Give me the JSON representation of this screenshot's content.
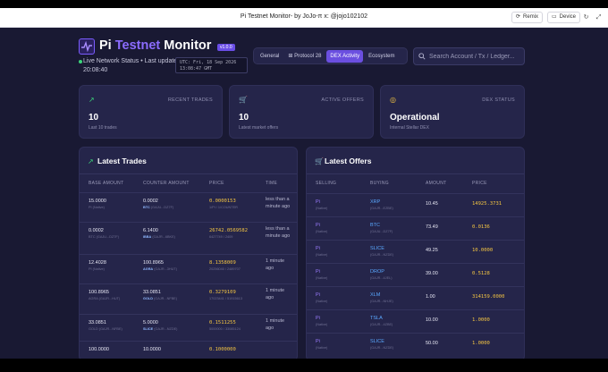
{
  "browser": {
    "title": "Pi Testnet Monitor- by JoJo-π x: @jojo102102",
    "remix_label": "Remix",
    "device_label": "Device"
  },
  "header": {
    "title_pi": "Pi",
    "title_testnet": "Testnet",
    "title_monitor": "Monitor",
    "version": "v1.0.0",
    "status_text": "Live Network Status • Last updated 20:08:40",
    "utc_line1": "UTC: Fri, 18 Sep 2026",
    "utc_line2": "13:08:47 GMT"
  },
  "tabs": [
    {
      "label": "General"
    },
    {
      "label": "Protocol 28"
    },
    {
      "label": "DEX Activity"
    },
    {
      "label": "Ecosystem"
    }
  ],
  "search": {
    "placeholder": "Search Account / Tx / Ledger..."
  },
  "cards": [
    {
      "label": "RECENT TRADES",
      "value": "10",
      "sub": "Last 10 trades"
    },
    {
      "label": "ACTIVE OFFERS",
      "value": "10",
      "sub": "Latest market offers"
    },
    {
      "label": "DEX STATUS",
      "value": "Operational",
      "sub": "Internal Stellar DEX"
    }
  ],
  "trades": {
    "title": "Latest Trades",
    "headers": [
      "BASE AMOUNT",
      "COUNTER AMOUNT",
      "PRICE",
      "TIME"
    ],
    "rows": [
      {
        "base": "15.0000",
        "base_sub": "PI (Native)",
        "counter": "0.0002",
        "counter_tk": "BTC",
        "counter_sub": "(GAJU...DZ7F)",
        "price": "0.0000153",
        "price_sub": "1/PI / 1/COUNTER",
        "time": "less than a minute ago"
      },
      {
        "base": "0.0002",
        "base_sub": "BTC (GAJU...DZ7F)",
        "counter": "6.1400",
        "counter_tk": "IBBA",
        "counter_sub": "(GAJR...6BKE)",
        "price": "26742.0569582",
        "price_sub": "6427749 / 2409",
        "time": "less than a minute ago"
      },
      {
        "base": "12.4028",
        "base_sub": "PI (Native)",
        "counter": "100.8965",
        "counter_tk": "AGRA",
        "counter_sub": "(GAJR...3HUT)",
        "price": "8.1358009",
        "price_sub": "20256040 / 2489707",
        "time": "1 minute ago"
      },
      {
        "base": "100.8965",
        "base_sub": "AGRA (GAJR...HUT)",
        "counter": "33.0851",
        "counter_tk": "GOLD",
        "counter_sub": "(GAJR...NFBE)",
        "price": "0.3279109",
        "price_sub": "17023441 / 51915613",
        "time": "1 minute ago"
      },
      {
        "base": "33.0851",
        "base_sub": "GOLD (GAJR...NFBE)",
        "counter": "5.0000",
        "counter_tk": "SLICE",
        "counter_sub": "(GAJR...NZDE)",
        "price": "0.1511255",
        "price_sub": "5000000 / 33085124",
        "time": "1 minute ago"
      },
      {
        "base": "100.0000",
        "base_sub": "",
        "counter": "10.0000",
        "counter_tk": "",
        "counter_sub": "",
        "price": "0.1000000",
        "price_sub": "",
        "time": ""
      }
    ]
  },
  "offers": {
    "title": "Latest Offers",
    "headers": [
      "SELLING",
      "BUYING",
      "AMOUNT",
      "PRICE"
    ],
    "rows": [
      {
        "selling": "Pi",
        "selling_sub": "(Native)",
        "buying": "XRP",
        "buying_sub": "(GAJR...EZBE)",
        "amount": "10.45",
        "price": "14925.3731"
      },
      {
        "selling": "Pi",
        "selling_sub": "(Native)",
        "buying": "BTC",
        "buying_sub": "(GAJU...DZ7F)",
        "amount": "73.49",
        "price": "0.0136"
      },
      {
        "selling": "Pi",
        "selling_sub": "(Native)",
        "buying": "SLICE",
        "buying_sub": "(GAJR...NZDE)",
        "amount": "49.25",
        "price": "10.0000"
      },
      {
        "selling": "Pi",
        "selling_sub": "(Native)",
        "buying": "DROP",
        "buying_sub": "(GAJR...4JEL)",
        "amount": "39.00",
        "price": "0.5128"
      },
      {
        "selling": "Pi",
        "selling_sub": "(Native)",
        "buying": "XLM",
        "buying_sub": "(GAJR...NHJE)",
        "amount": "1.00",
        "price": "314159.0000"
      },
      {
        "selling": "Pi",
        "selling_sub": "(Native)",
        "buying": "TSLA",
        "buying_sub": "(GAJR...4ZBE)",
        "amount": "10.00",
        "price": "1.0000"
      },
      {
        "selling": "Pi",
        "selling_sub": "(Native)",
        "buying": "SLICE",
        "buying_sub": "(GAJR...NZDE)",
        "amount": "50.00",
        "price": "1.0000"
      }
    ]
  },
  "colors": {
    "accent": "#6b4fe0",
    "price": "#f4c542",
    "green": "#3bd47a",
    "link": "#8b6cff"
  }
}
